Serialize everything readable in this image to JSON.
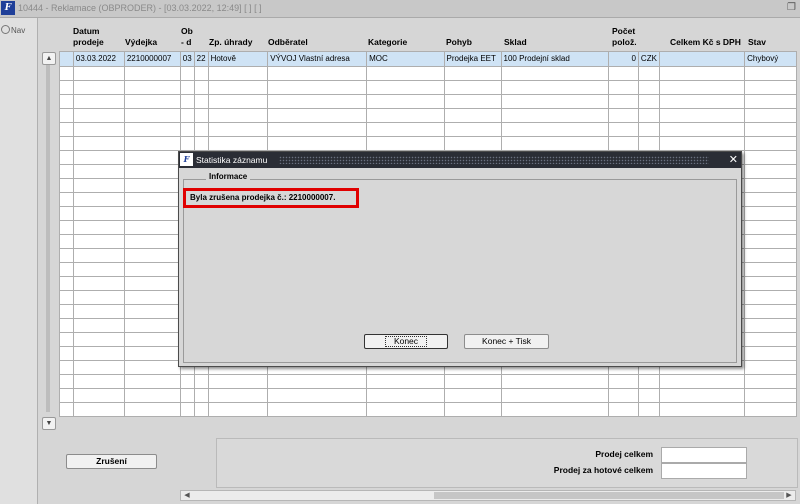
{
  "window": {
    "app_logo": "F",
    "title": "10444 - Reklamace (OBPRODER) - [03.03.2022, 12:49]  [ ]  [ ]"
  },
  "nav": {
    "label": "Nav"
  },
  "columns": {
    "datum_prodeje": "Datum prodeje",
    "vydejka": "Výdejka",
    "obdobi": "Ob- dobí",
    "zp_uhrady": "Zp. úhrady",
    "odberatel": "Odběratel",
    "kategorie": "Kategorie",
    "pohyb": "Pohyb",
    "sklad": "Sklad",
    "pocet_poloz": "Počet polož.",
    "celkem_kc": "Celkem Kč s DPH",
    "stav": "Stav"
  },
  "row1": {
    "datum": "03.03.2022",
    "vydejka": "2210000007",
    "ob1": "03",
    "ob2": "22",
    "zp": "Hotově",
    "odberatel": "VÝVOJ Vlastní adresa",
    "kategorie": "MOC",
    "pohyb": "Prodejka EET",
    "sklad": "100 Prodejní sklad",
    "pocet": "0",
    "mena": "CZK",
    "celkem": "",
    "stav": "Chybový"
  },
  "buttons": {
    "zruseni": "Zrušení"
  },
  "totals": {
    "prodej_celkem": "Prodej celkem",
    "prodej_hotove": "Prodej za hotové celkem"
  },
  "dialog": {
    "logo": "F",
    "title": "Statistika záznamu",
    "section": "Informace",
    "message": "Byla zrušena prodejka č.: 2210000007.",
    "konec": "Konec",
    "konec_tisk": "Konec + Tisk"
  }
}
